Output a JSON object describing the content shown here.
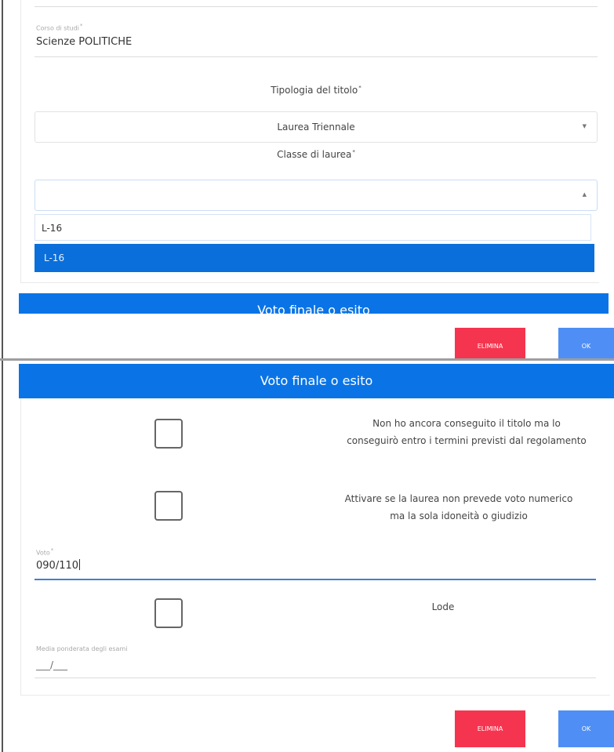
{
  "top": {
    "corso_label": "Corso di studi",
    "corso_value": "Scienze POLITICHE",
    "tipologia_label": "Tipologia del titolo",
    "tipologia_selected": "Laurea Triennale",
    "classe_label": "Classe di laurea",
    "classe_search": "L-16",
    "classe_options": [
      "L-16"
    ],
    "partial_header": "Voto finale o esito",
    "delete_label": "ELIMINA",
    "ok_label": "OK"
  },
  "bottom": {
    "section_title": "Voto finale o esito",
    "check1_text_line1": "Non ho ancora conseguito il titolo ma lo",
    "check1_text_line2": "conseguirò entro i termini previsti dal regolamento",
    "check2_text_line1": "Attivare se la laurea non prevede voto numerico",
    "check2_text_line2": "ma la sola idoneità o giudizio",
    "voto_label": "Voto",
    "voto_value": "090/110",
    "lode_label": "Lode",
    "media_label": "Media ponderata degli esami",
    "media_placeholder": "___/___",
    "delete_label": "ELIMINA",
    "ok_label": "OK"
  },
  "colors": {
    "primary_blue": "#0a74e6",
    "selected_option": "#0a6fdb",
    "delete_red": "#f5354f",
    "ok_blue": "#4f8ff5"
  },
  "icons": {
    "dropdown_closed": "caret-down-icon",
    "dropdown_open": "caret-up-icon"
  },
  "required_mark": "*"
}
